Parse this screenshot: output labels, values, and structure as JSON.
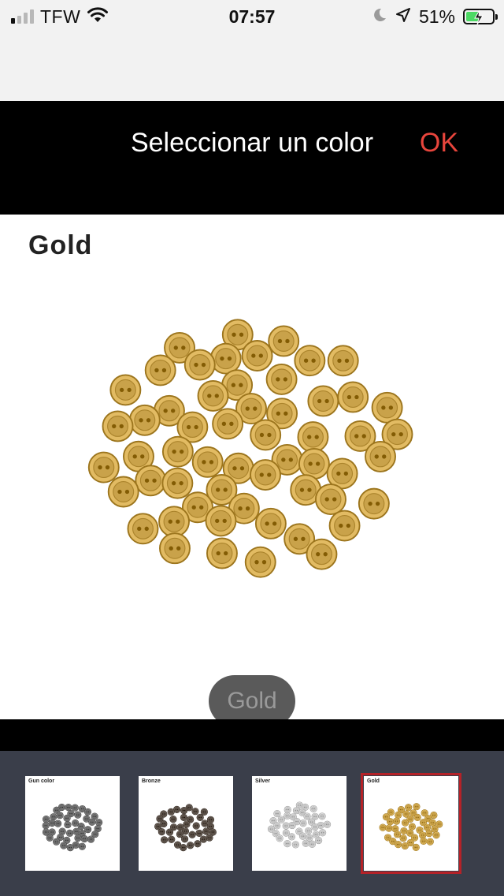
{
  "status_bar": {
    "carrier": "TFW",
    "time": "07:57",
    "battery_percent": "51%",
    "battery_level": 0.51,
    "icons": [
      "signal-icon",
      "wifi-icon",
      "moon-icon",
      "location-arrow-icon",
      "battery-charging-icon"
    ]
  },
  "header": {
    "title": "Seleccionar un color",
    "ok_label": "OK",
    "ok_color": "#e8453c"
  },
  "main_image": {
    "label": "Gold",
    "caption": "Gold"
  },
  "thumbnails": [
    {
      "label": "Gun color",
      "selected": false,
      "tone": "#6e6e6e"
    },
    {
      "label": "Bronze",
      "selected": false,
      "tone": "#5a5048"
    },
    {
      "label": "Silver",
      "selected": false,
      "tone": "#c8c8c8"
    },
    {
      "label": "Gold",
      "selected": true,
      "tone": "#c9a24a"
    }
  ],
  "colors": {
    "header_bg": "#000000",
    "thumb_bar_bg": "#3a3e4a",
    "selected_outline": "#b52228"
  }
}
